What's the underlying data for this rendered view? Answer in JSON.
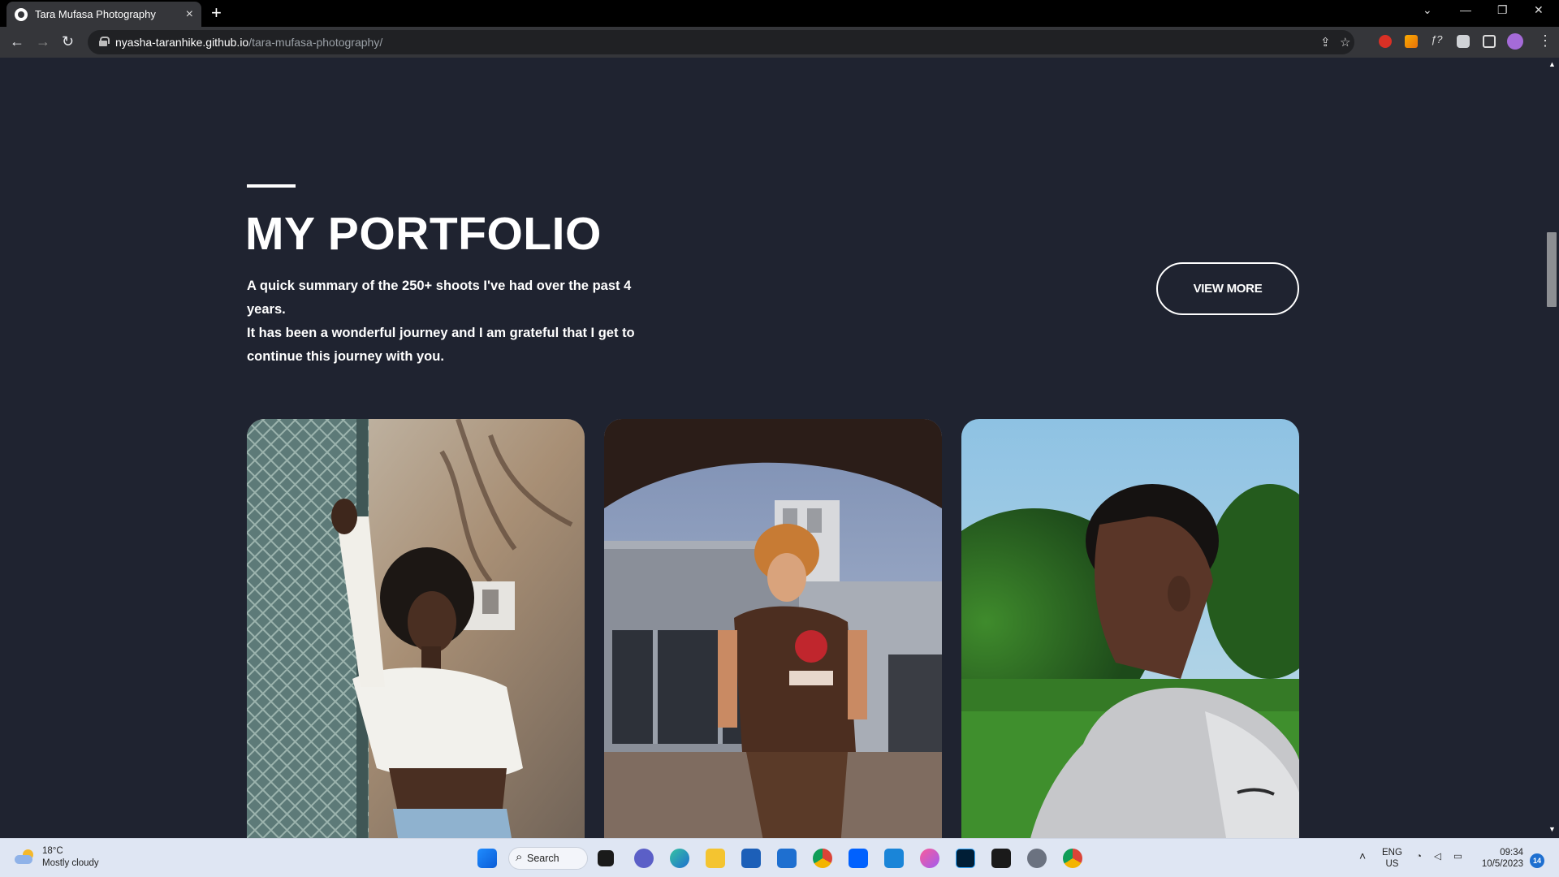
{
  "browser": {
    "tab_title": "Tara Mufasa Photography",
    "url_host": "nyasha-taranhike.github.io",
    "url_path": "/tara-mufasa-photography/"
  },
  "portfolio": {
    "title": "MY PORTFOLIO",
    "description_line1": "A quick summary of the 250+ shoots I've had over the past 4 years.",
    "description_line2": "It has been a wonderful journey and I am grateful that I get to continue this journey with you.",
    "view_more_label": "VIEW MORE"
  },
  "taskbar": {
    "weather_temp": "18°C",
    "weather_desc": "Mostly cloudy",
    "search_label": "Search",
    "language": "ENG",
    "region": "US",
    "time": "09:34",
    "date": "10/5/2023",
    "notification_count": "14"
  },
  "colors": {
    "page_background": "#1f2330",
    "text": "#ffffff",
    "taskbar": "#dfe6f3"
  }
}
